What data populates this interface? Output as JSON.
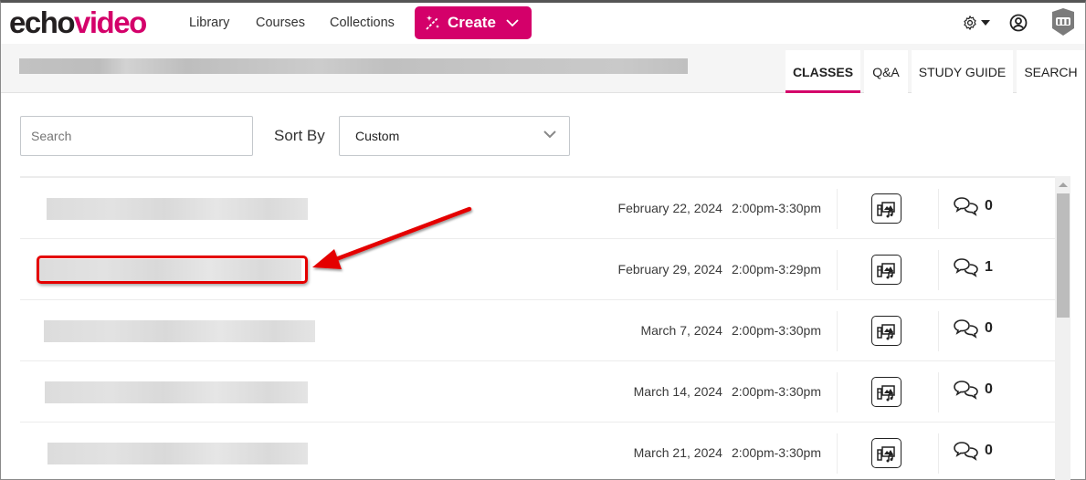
{
  "header": {
    "logo_part1": "echo",
    "logo_part2": "video",
    "nav": [
      "Library",
      "Courses",
      "Collections"
    ],
    "create_label": "Create",
    "brand_color": "#d4006a",
    "icons": [
      "gear-icon",
      "user-profile-icon",
      "institution-icon"
    ]
  },
  "subheader": {
    "course_title": "",
    "tabs": [
      {
        "label": "CLASSES",
        "active": true
      },
      {
        "label": "Q&A",
        "active": false
      },
      {
        "label": "STUDY GUIDE",
        "active": false
      },
      {
        "label": "SEARCH",
        "active": false
      }
    ]
  },
  "controls": {
    "search_placeholder": "Search",
    "sort_label": "Sort By",
    "sort_value": "Custom"
  },
  "classes": [
    {
      "date": "February 22, 2024",
      "time": "2:00pm-3:30pm",
      "comments": "0"
    },
    {
      "date": "February 29, 2024",
      "time": "2:00pm-3:29pm",
      "comments": "1"
    },
    {
      "date": "March 7, 2024",
      "time": "2:00pm-3:30pm",
      "comments": "0"
    },
    {
      "date": "March 14, 2024",
      "time": "2:00pm-3:30pm",
      "comments": "0"
    },
    {
      "date": "March 21, 2024",
      "time": "2:00pm-3:30pm",
      "comments": "0"
    }
  ],
  "annotation": {
    "highlight_color": "#e40000",
    "target_row": 2
  }
}
